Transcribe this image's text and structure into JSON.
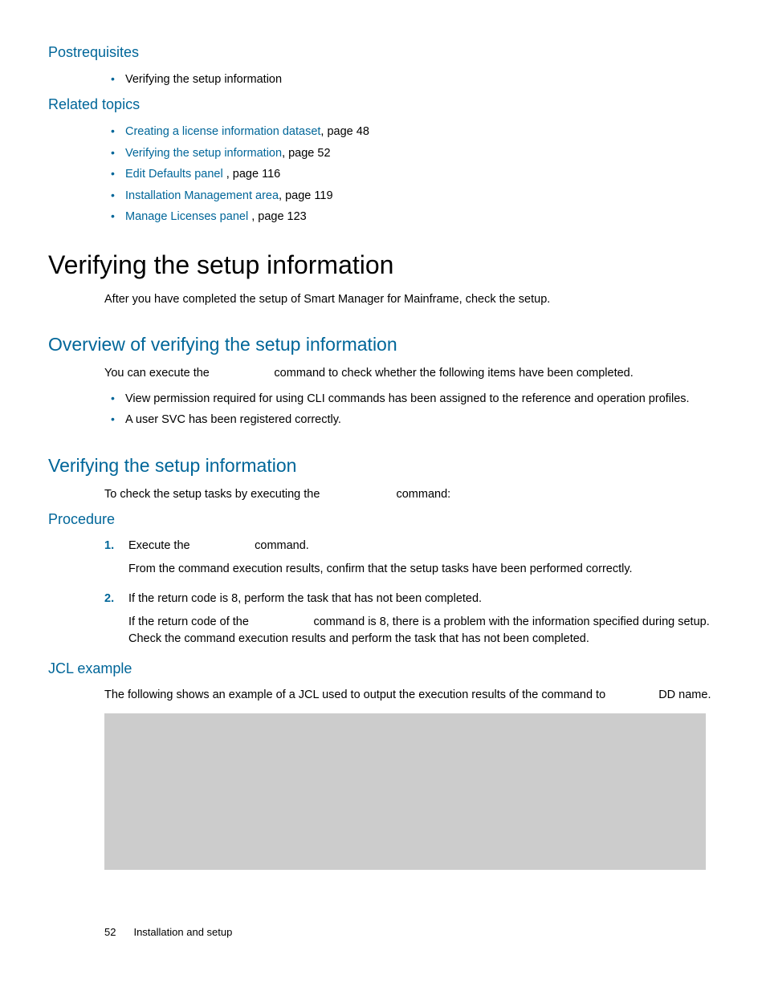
{
  "postrequisites": {
    "heading": "Postrequisites",
    "items": [
      {
        "text": "Verifying the setup information"
      }
    ]
  },
  "related_topics": {
    "heading": "Related topics",
    "items": [
      {
        "link": "Creating a license information dataset",
        "suffix": ", page 48"
      },
      {
        "link": "Verifying the setup information",
        "suffix": ", page 52"
      },
      {
        "link": "Edit Defaults panel ",
        "suffix": ", page 116"
      },
      {
        "link": "Installation Management area",
        "suffix": ", page 119"
      },
      {
        "link": "Manage Licenses panel ",
        "suffix": ", page 123"
      }
    ]
  },
  "main_heading": "Verifying the setup information",
  "main_intro": "After you have completed the setup of Smart Manager for Mainframe, check the setup.",
  "overview": {
    "heading": "Overview of verifying the setup information",
    "intro_before": "You can execute the ",
    "intro_after": " command to check whether the following items have been completed.",
    "bullets": [
      "View permission required for using CLI commands has been assigned to the reference and operation profiles.",
      "A user SVC has been registered correctly."
    ]
  },
  "verifying": {
    "heading": "Verifying the setup information",
    "intro_before": "To check the setup tasks by executing the ",
    "intro_after": " command:"
  },
  "procedure": {
    "heading": "Procedure",
    "steps": [
      {
        "line1_before": "Execute the ",
        "line1_after": " command.",
        "detail": "From the command execution results, confirm that the setup tasks have been performed correctly."
      },
      {
        "line1": "If the return code is 8, perform the task that has not been completed.",
        "detail_before": "If the return code of the ",
        "detail_after": " command is 8, there is a problem with the information specified during setup. Check the command execution results and perform the task that has not been completed."
      }
    ]
  },
  "jcl": {
    "heading": "JCL example",
    "intro_before": "The following shows an example of a JCL used to output the execution results of the ",
    "intro_mid": " command to ",
    "intro_after": " DD name."
  },
  "footer": {
    "page_number": "52",
    "section": "Installation and setup"
  },
  "gap10": "     ",
  "gap12": "      ",
  "gap8": "    "
}
